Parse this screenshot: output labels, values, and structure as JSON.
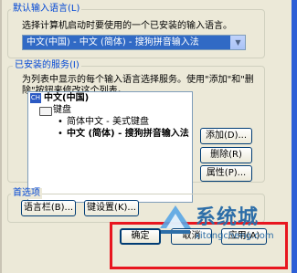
{
  "default_language": {
    "legend": "默认输入语言(L)",
    "description": "选择计算机启动时要使用的一个已安装的输入语言。",
    "selected": "中文(中国) - 中文 (简体) - 搜狗拼音输入法"
  },
  "installed": {
    "legend": "已安装的服务(I)",
    "description_1": "为列表中显示的每个输入语言选择服务。使用\"添加\"和\"删",
    "description_2": "除\"按钮来修改这个列表。",
    "tree": {
      "language": "中文(中国)",
      "language_badge": "CH",
      "keyboard": "键盘",
      "services": [
        "简体中文 - 美式键盘",
        "中文 (简体) - 搜狗拼音输入法"
      ]
    },
    "add_label": "添加(D)...",
    "remove_label": "删除(R)",
    "properties_label": "属性(P)..."
  },
  "preferences": {
    "legend": "首选项",
    "language_bar_label": "语言栏(B)...",
    "key_settings_label": "键设置(K)..."
  },
  "footer": {
    "ok_label": "确定",
    "cancel_label": "取消",
    "apply_label": "应用(A)"
  },
  "watermark": {
    "title": "系统城",
    "url": "xitongcheng.com"
  },
  "colors": {
    "highlight": "#e8161f",
    "selection": "#316ac5",
    "group_title": "#0046d5",
    "watermark": "#2d6ea8"
  }
}
